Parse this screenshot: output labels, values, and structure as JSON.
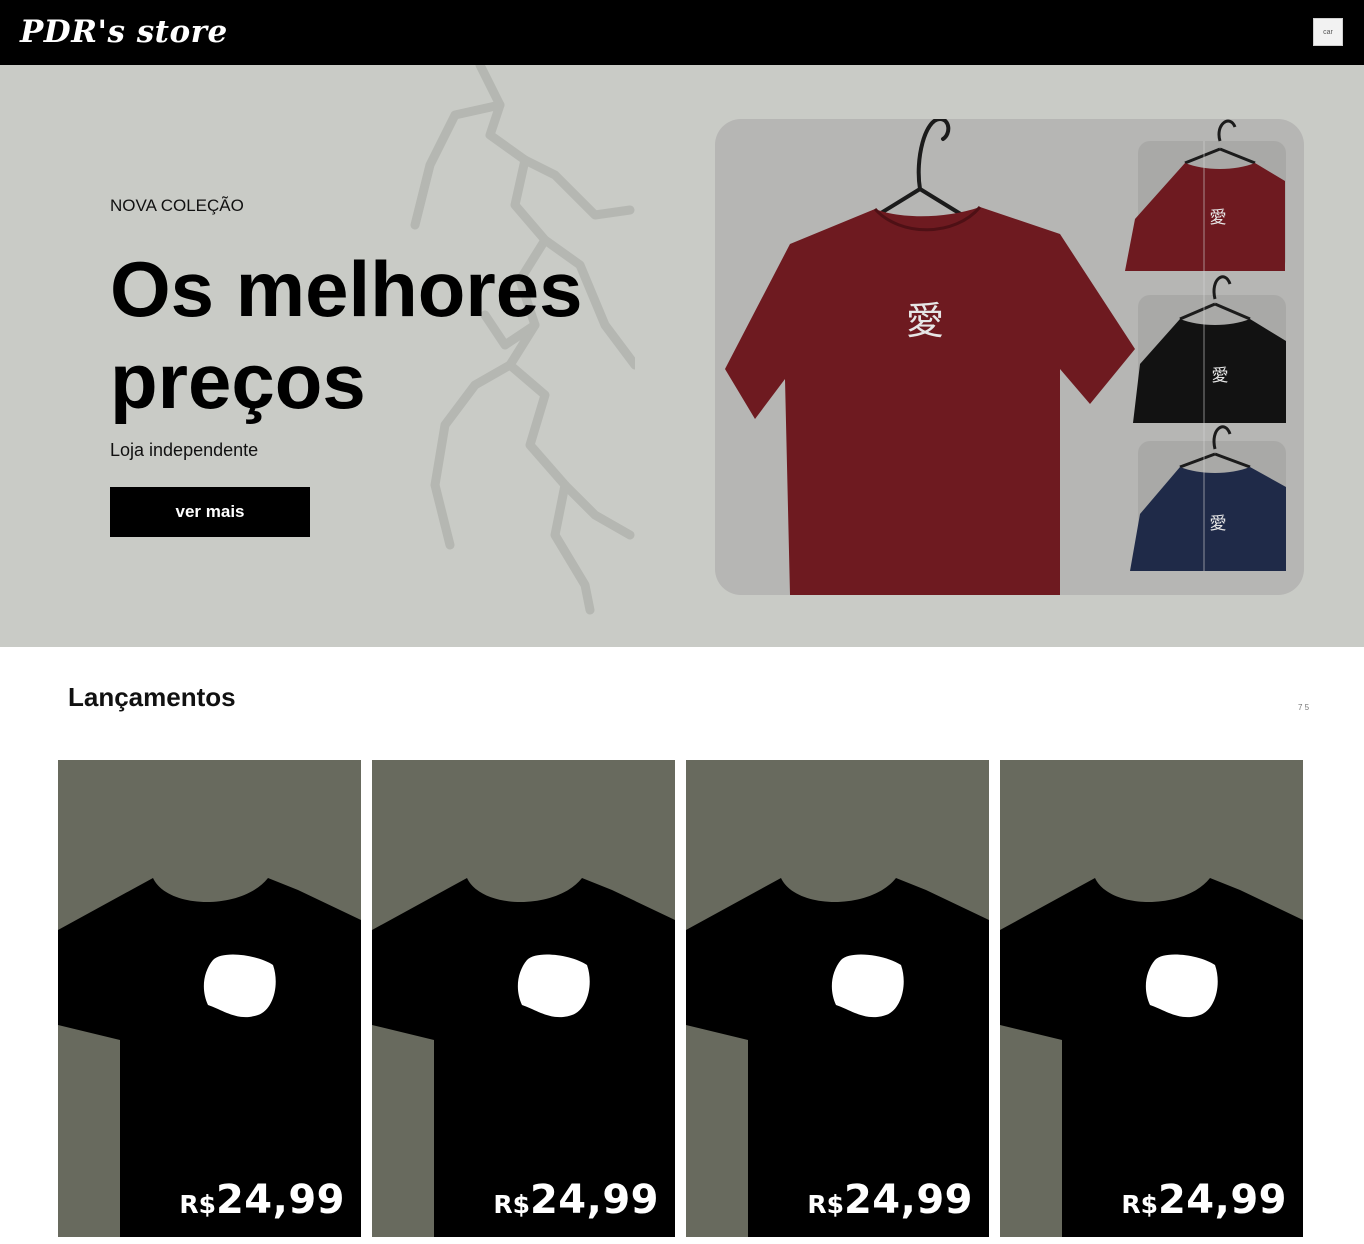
{
  "header": {
    "logo": "PDR's store",
    "cart_label": "car"
  },
  "hero": {
    "kicker": "NOVA COLEÇÃO",
    "headline": "Os melhores preços",
    "subtitle": "Loja independente",
    "cta_label": "ver mais",
    "photo_glyph": "愛"
  },
  "releases": {
    "title": "Lançamentos",
    "more": "7 5",
    "products": [
      {
        "currency": "R$",
        "price": "24,99"
      },
      {
        "currency": "R$",
        "price": "24,99"
      },
      {
        "currency": "R$",
        "price": "24,99"
      },
      {
        "currency": "R$",
        "price": "24,99"
      }
    ]
  },
  "colors": {
    "header_bg": "#000000",
    "hero_bg": "#c9cbc6",
    "card_bg": "#686a5e",
    "shirt_maroon": "#6e1a20",
    "shirt_navy": "#1f2a48"
  }
}
